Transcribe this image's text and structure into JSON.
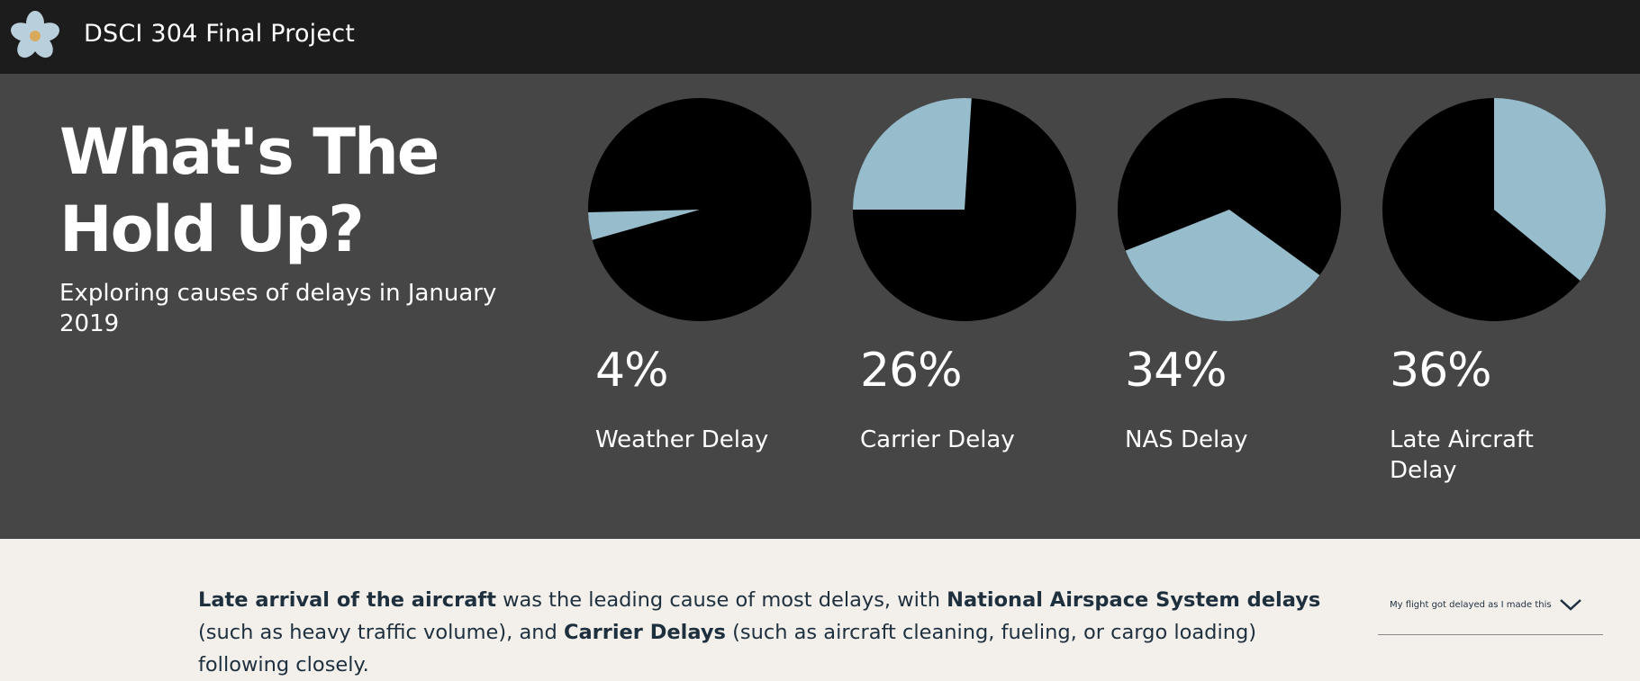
{
  "header": {
    "logo_icon": "flower-icon",
    "site_title": "DSCI 304 Final Project"
  },
  "hero": {
    "title": "What's The Hold Up?",
    "subtitle": "Exploring causes of delays in January 2019"
  },
  "colors": {
    "pie_highlight": "#97bccb",
    "pie_rest": "#000000",
    "hero_bg": "#464646",
    "topbar_bg": "#1c1c1c",
    "bottom_bg": "#f3f0ec",
    "text_dark": "#1e2f3d"
  },
  "chart_data": [
    {
      "type": "pie",
      "title": "Weather Delay",
      "value_label": "4%",
      "slices": [
        {
          "value": 4
        },
        {
          "value": 96
        }
      ]
    },
    {
      "type": "pie",
      "title": "Carrier Delay",
      "value_label": "26%",
      "slices": [
        {
          "value": 26
        },
        {
          "value": 74
        }
      ]
    },
    {
      "type": "pie",
      "title": "NAS Delay",
      "value_label": "34%",
      "slices": [
        {
          "value": 34
        },
        {
          "value": 66
        }
      ]
    },
    {
      "type": "pie",
      "title": "Late Aircraft Delay",
      "value_label": "36%",
      "slices": [
        {
          "value": 36
        },
        {
          "value": 64
        }
      ]
    }
  ],
  "summary": {
    "bold1": "Late arrival of the aircraft",
    "text1": " was the leading cause of most delays, with ",
    "bold2": "National Airspace System delays",
    "text2": " (such as heavy traffic volume), and ",
    "bold3": "Carrier Delays",
    "text3": " (such as aircraft cleaning, fueling, or cargo loading) following closely."
  },
  "dropdown": {
    "label": "My flight got delayed as I made this",
    "icon": "chevron-down-icon"
  }
}
